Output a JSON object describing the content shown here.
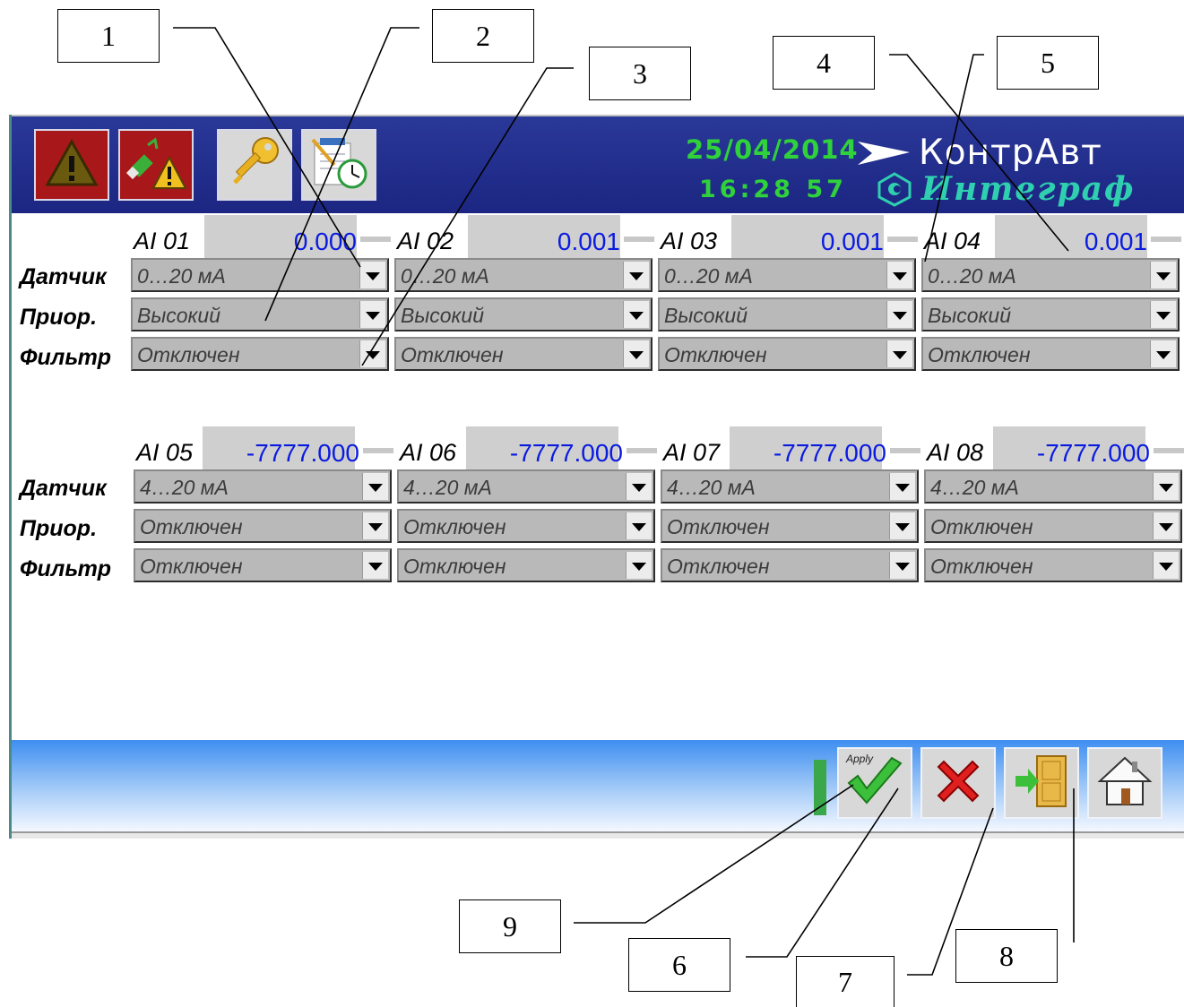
{
  "callouts": [
    "1",
    "2",
    "3",
    "4",
    "5",
    "6",
    "7",
    "8",
    "9"
  ],
  "header": {
    "date": "25/04/2014",
    "time": "16:28 57",
    "brand": "КонтрАвт",
    "brand2": "Интеграф",
    "buttons": [
      "alarm-warning",
      "usb-warning",
      "key",
      "schedule-clock"
    ]
  },
  "row_labels": {
    "sensor": "Датчик",
    "priority": "Приор.",
    "filter": "Фильтр"
  },
  "groups": [
    {
      "channels": [
        {
          "name": "AI 01",
          "value": "0.000",
          "sensor": "0…20 мА",
          "priority": "Высокий",
          "filter": "Отключен"
        },
        {
          "name": "AI 02",
          "value": "0.001",
          "sensor": "0…20 мА",
          "priority": "Высокий",
          "filter": "Отключен"
        },
        {
          "name": "AI 03",
          "value": "0.001",
          "sensor": "0…20 мА",
          "priority": "Высокий",
          "filter": "Отключен"
        },
        {
          "name": "AI 04",
          "value": "0.001",
          "sensor": "0…20 мА",
          "priority": "Высокий",
          "filter": "Отключен"
        }
      ]
    },
    {
      "channels": [
        {
          "name": "AI 05",
          "value": "-7777.000",
          "sensor": "4…20 мА",
          "priority": "Отключен",
          "filter": "Отключен"
        },
        {
          "name": "AI 06",
          "value": "-7777.000",
          "sensor": "4…20 мА",
          "priority": "Отключен",
          "filter": "Отключен"
        },
        {
          "name": "AI 07",
          "value": "-7777.000",
          "sensor": "4…20 мА",
          "priority": "Отключен",
          "filter": "Отключен"
        },
        {
          "name": "AI 08",
          "value": "-7777.000",
          "sensor": "4…20 мА",
          "priority": "Отключен",
          "filter": "Отключен"
        }
      ]
    }
  ],
  "footer": {
    "apply_label": "Apply",
    "buttons": [
      "apply",
      "cancel",
      "exit",
      "home"
    ]
  },
  "colors": {
    "header_bg": "#1c2682",
    "clock": "#2fd23a",
    "value": "#0a1be0",
    "alarm_btn": "#a8171a"
  }
}
